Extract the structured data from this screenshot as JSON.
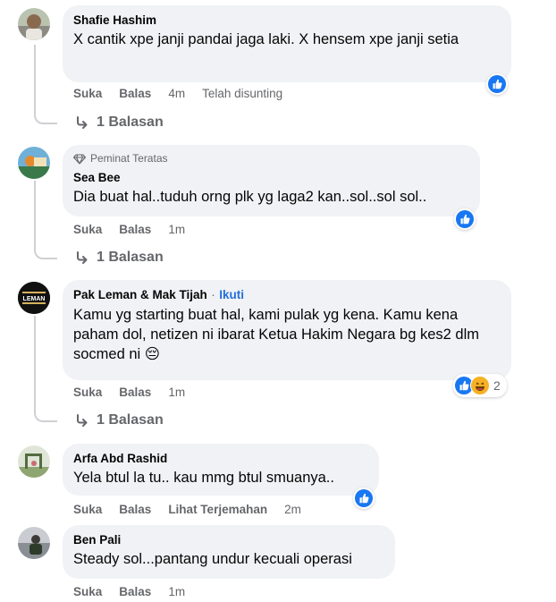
{
  "comments": [
    {
      "author": "Shafie Hashim",
      "text": "X cantik xpe janji pandai jaga laki. X hensem xpe janji setia",
      "actions": {
        "like": "Suka",
        "reply": "Balas",
        "time": "4m",
        "edited": "Telah disunting"
      },
      "replies": "1 Balasan"
    },
    {
      "badge": "Peminat Teratas",
      "author": "Sea Bee",
      "text": "Dia buat hal..tuduh orng plk yg laga2 kan..sol..sol sol..",
      "actions": {
        "like": "Suka",
        "reply": "Balas",
        "time": "1m"
      },
      "replies": "1 Balasan"
    },
    {
      "author": "Pak Leman & Mak Tijah",
      "separator": "·",
      "follow": "Ikuti",
      "text": "Kamu yg starting buat hal, kami pulak yg kena. Kamu kena paham dol, netizen ni ibarat Ketua Hakim Negara bg kes2 dlm socmed ni 😔",
      "actions": {
        "like": "Suka",
        "reply": "Balas",
        "time": "1m"
      },
      "reaction_count": "2",
      "replies": "1 Balasan"
    },
    {
      "author": "Arfa Abd Rashid",
      "text": "Yela btul la tu.. kau mmg btul smuanya..",
      "actions": {
        "like": "Suka",
        "reply": "Balas",
        "translate": "Lihat Terjemahan",
        "time": "2m"
      }
    },
    {
      "author": "Ben Pali",
      "text": "Steady sol...pantang undur kecuali operasi",
      "actions": {
        "like": "Suka",
        "reply": "Balas",
        "time": "1m"
      }
    }
  ],
  "avatar_texts": {
    "pak_leman": "LEMAN"
  },
  "icons": {
    "like": "thumbs-up-icon",
    "haha": "laughing-face-icon",
    "reply_arrow": "reply-arrow-icon",
    "badge": "diamond-icon"
  },
  "colors": {
    "bubble": "#f0f2f5",
    "like_blue": "#1877f2",
    "follow": "#216fdb",
    "meta": "#65676b"
  }
}
